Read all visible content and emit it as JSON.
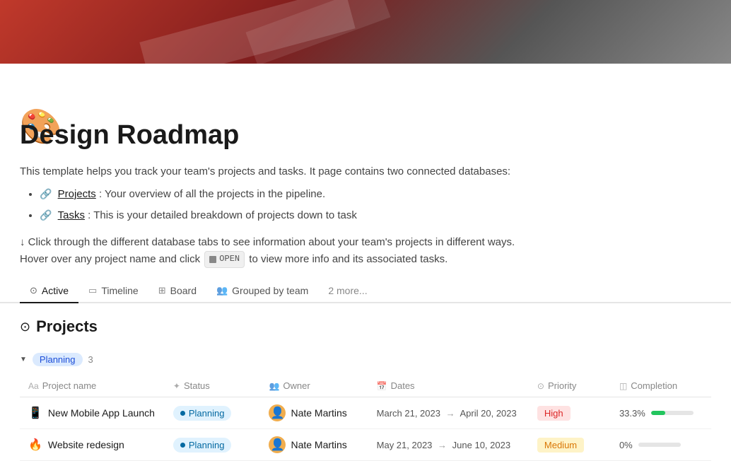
{
  "banner": {
    "alt": "Design Roadmap banner"
  },
  "page": {
    "icon": "🎨",
    "title": "Design Roadmap",
    "description": "This template helps you track your team's projects and tasks. It page contains two connected databases:",
    "bullets": [
      {
        "icon": "🔗",
        "link_text": "Projects",
        "text": ": Your overview of all the projects in the pipeline."
      },
      {
        "icon": "🔗",
        "link_text": "Tasks",
        "text": ": This is your detailed breakdown of projects down to task"
      }
    ],
    "instructions_1": "↓ Click through the different database tabs to see information about your team's projects in different ways.",
    "instructions_2": "Hover over any project name and click",
    "open_label": "OPEN",
    "instructions_3": "to view more info and its associated tasks."
  },
  "tabs": [
    {
      "id": "active",
      "label": "Active",
      "icon": "⊙",
      "active": true
    },
    {
      "id": "timeline",
      "label": "Timeline",
      "icon": "▭"
    },
    {
      "id": "board",
      "label": "Board",
      "icon": "⊞"
    },
    {
      "id": "grouped-by-team",
      "label": "Grouped by team",
      "icon": "👥"
    },
    {
      "id": "more",
      "label": "2 more..."
    }
  ],
  "database": {
    "icon": "⊙",
    "title": "Projects",
    "group": {
      "label": "Planning",
      "count": "3",
      "expanded": true
    },
    "columns": [
      {
        "id": "project-name",
        "label": "Project name",
        "icon": "Aa"
      },
      {
        "id": "status",
        "label": "Status",
        "icon": "✦"
      },
      {
        "id": "owner",
        "label": "Owner",
        "icon": "👥"
      },
      {
        "id": "dates",
        "label": "Dates",
        "icon": "📅"
      },
      {
        "id": "priority",
        "label": "Priority",
        "icon": "⊙"
      },
      {
        "id": "completion",
        "label": "Completion",
        "icon": "◫"
      }
    ],
    "rows": [
      {
        "id": "row-1",
        "name": "New Mobile App Launch",
        "emoji": "📱",
        "status": "Planning",
        "status_type": "planning",
        "owner": "Nate Martins",
        "owner_emoji": "👤",
        "date_start": "March 21, 2023",
        "date_end": "April 20, 2023",
        "priority": "High",
        "priority_type": "high",
        "completion": "33.3%",
        "progress": 33
      },
      {
        "id": "row-2",
        "name": "Website redesign",
        "emoji": "🔥",
        "status": "Planning",
        "status_type": "planning",
        "owner": "Nate Martins",
        "owner_emoji": "👤",
        "date_start": "May 21, 2023",
        "date_end": "June 10, 2023",
        "priority": "Medium",
        "priority_type": "medium",
        "completion": "0%",
        "progress": 0
      }
    ]
  }
}
